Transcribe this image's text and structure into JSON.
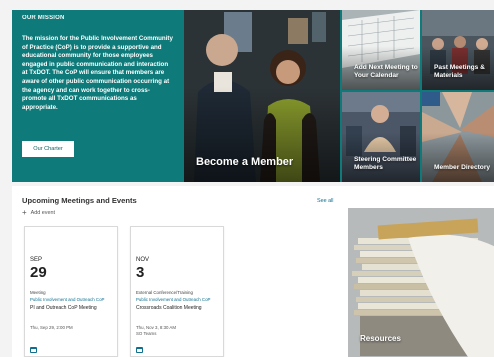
{
  "mission": {
    "heading": "OUR MISSION",
    "body": "The mission for the Public Involvement Community of Practice (CoP) is to provide a supportive and educational community for those employees engaged in public communication and interaction at TxDOT. The CoP will ensure that members are aware of other public communication occurring at the agency and can work together to cross-promote all TxDOT communications as appropriate.",
    "button_label": "Our Charter"
  },
  "tiles": {
    "member": "Become a Member",
    "calendar": "Add Next Meeting to Your Calendar",
    "materials": "Past Meetings & Materials",
    "steering": "Steering Committee Members",
    "directory": "Member Directory"
  },
  "events": {
    "title": "Upcoming Meetings and Events",
    "see_all": "See all",
    "add_event": "Add event",
    "items": [
      {
        "month": "SEP",
        "day": "29",
        "category": "Meeting",
        "subcategory": "Public Involvement and Outreach CoP",
        "title": "PI and Outreach CoP Meeting",
        "date": "Thu, Sep 29, 2:00 PM",
        "location": ""
      },
      {
        "month": "NOV",
        "day": "3",
        "category": "External Conference/Training",
        "subcategory": "Public Involvement and Outreach CoP",
        "title": "Crossroads Coalition Meeting",
        "date": "Thu, Nov 3, 8:30 AM",
        "location": "SO Teams"
      }
    ]
  },
  "resources": {
    "label": "Resources"
  },
  "colors": {
    "brand_teal": "#0e7a79",
    "link": "#0e6f8f"
  }
}
